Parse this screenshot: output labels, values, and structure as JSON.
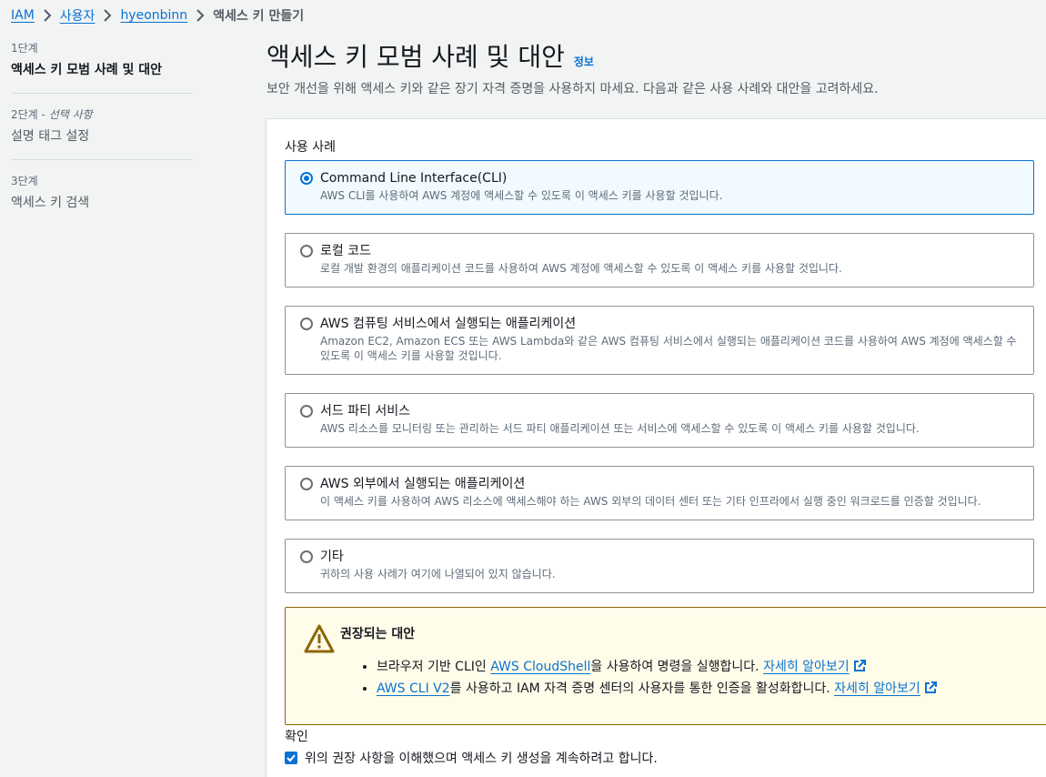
{
  "breadcrumb": {
    "items": [
      "IAM",
      "사용자",
      "hyeonbinn"
    ],
    "current": "액세스 키 만들기"
  },
  "steps": [
    {
      "num": "1단계",
      "optional": "",
      "title": "액세스 키 모범 사례 및 대안"
    },
    {
      "num": "2단계 - ",
      "optional": "선택 사항",
      "title": "설명 태그 설정"
    },
    {
      "num": "3단계",
      "optional": "",
      "title": "액세스 키 검색"
    }
  ],
  "header": {
    "title": "액세스 키 모범 사례 및 대안",
    "info": "정보",
    "description": "보안 개선을 위해 액세스 키와 같은 장기 자격 증명을 사용하지 마세요. 다음과 같은 사용 사례와 대안을 고려하세요."
  },
  "use_case": {
    "label": "사용 사례",
    "options": [
      {
        "title": "Command Line Interface(CLI)",
        "desc": "AWS CLI를 사용하여 AWS 계정에 액세스할 수 있도록 이 액세스 키를 사용할 것입니다.",
        "selected": true
      },
      {
        "title": "로컬 코드",
        "desc": "로컬 개발 환경의 애플리케이션 코드를 사용하여 AWS 계정에 액세스할 수 있도록 이 액세스 키를 사용할 것입니다.",
        "selected": false
      },
      {
        "title": "AWS 컴퓨팅 서비스에서 실행되는 애플리케이션",
        "desc": "Amazon EC2, Amazon ECS 또는 AWS Lambda와 같은 AWS 컴퓨팅 서비스에서 실행되는 애플리케이션 코드를 사용하여 AWS 계정에 액세스할 수 있도록 이 액세스 키를 사용할 것입니다.",
        "selected": false
      },
      {
        "title": "서드 파티 서비스",
        "desc": "AWS 리소스를 모니터링 또는 관리하는 서드 파티 애플리케이션 또는 서비스에 액세스할 수 있도록 이 액세스 키를 사용할 것입니다.",
        "selected": false
      },
      {
        "title": "AWS 외부에서 실행되는 애플리케이션",
        "desc": "이 액세스 키를 사용하여 AWS 리소스에 액세스해야 하는 AWS 외부의 데이터 센터 또는 기타 인프라에서 실행 중인 워크로드를 인증할 것입니다.",
        "selected": false
      },
      {
        "title": "기타",
        "desc": "귀하의 사용 사례가 여기에 나열되어 있지 않습니다.",
        "selected": false
      }
    ]
  },
  "alert": {
    "title": "권장되는 대안",
    "item1": {
      "pre": "브라우저 기반 CLI인 ",
      "link": "AWS CloudShell",
      "post": "을 사용하여 명령을 실행합니다. ",
      "more": "자세히 알아보기"
    },
    "item2": {
      "link": "AWS CLI V2",
      "post": "를 사용하고 IAM 자격 증명 센터의 사용자를 통한 인증을 활성화합니다. ",
      "more": "자세히 알아보기"
    }
  },
  "confirm": {
    "label": "확인",
    "checkbox_text": "위의 권장 사항을 이해했으며 액세스 키 생성을 계속하려고 합니다.",
    "checked": true
  },
  "colors": {
    "accent": "#0972d3",
    "warning": "#8d6605",
    "warning_bg": "#fffce9"
  }
}
